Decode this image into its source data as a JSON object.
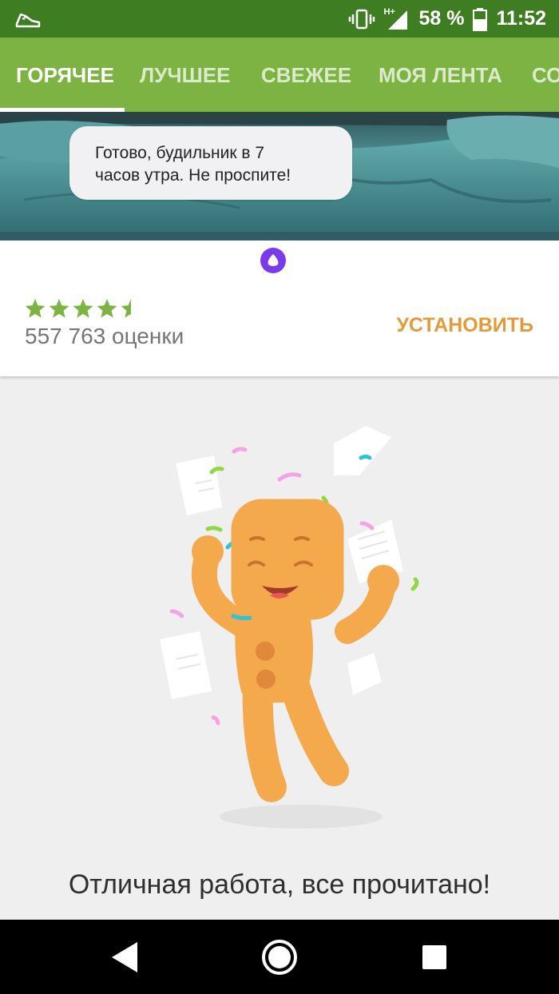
{
  "status_bar": {
    "network": "H+",
    "battery": "58 %",
    "time": "11:52",
    "icons": [
      "sneaker-icon",
      "vibrate-icon",
      "signal-icon",
      "battery-icon"
    ]
  },
  "tabs": [
    {
      "label": "ГОРЯЧЕЕ",
      "active": true
    },
    {
      "label": "ЛУЧШЕЕ",
      "active": false
    },
    {
      "label": "СВЕЖЕЕ",
      "active": false
    },
    {
      "label": "МОЯ ЛЕНТА",
      "active": false
    },
    {
      "label": "СО",
      "active": false
    }
  ],
  "ad": {
    "bubble_line1": "Готово, будильник в 7",
    "bubble_line2": "часов утра. Не проспите!",
    "rating_value": 4.5,
    "rating_max": 5,
    "ratings_count": "557 763 оценки",
    "install_label": "УСТАНОВИТЬ",
    "colors": {
      "stars": "#7cb342",
      "install": "#e39b3a",
      "alice": "#7c3aed"
    }
  },
  "empty_state": {
    "message": "Отличная работа, все прочитано!"
  },
  "colors": {
    "status_bar": "#3e7d22",
    "tab_bar": "#7cb342",
    "background": "#efefef"
  }
}
